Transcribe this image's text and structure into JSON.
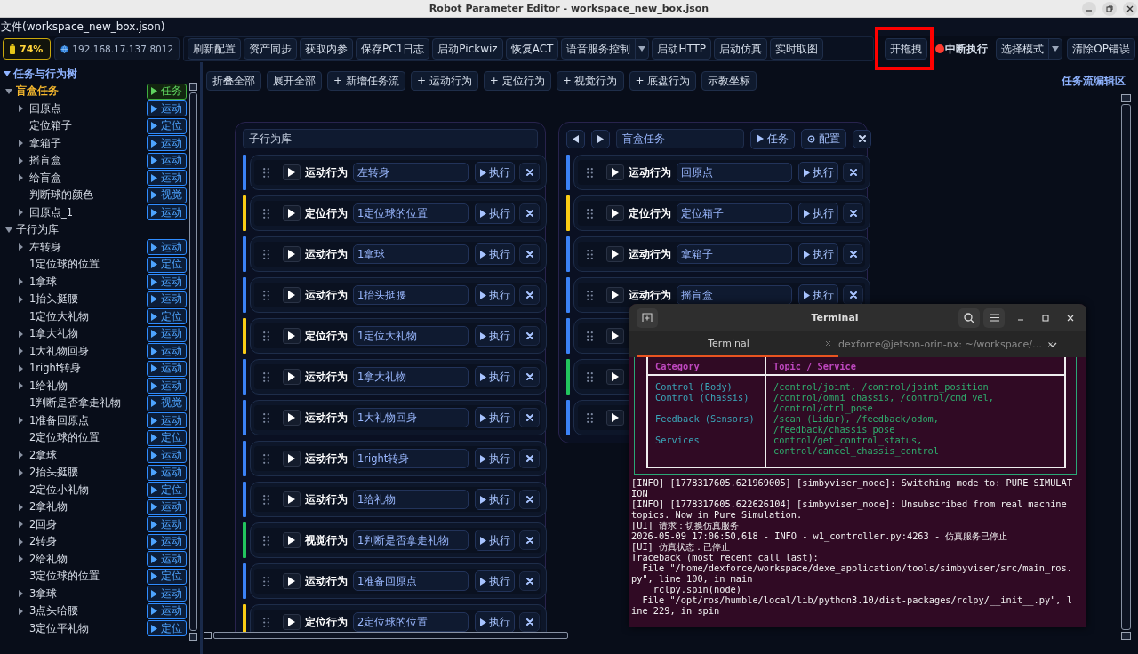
{
  "window": {
    "title": "Robot Parameter Editor - workspace_new_box.json"
  },
  "menu": {
    "file": "文件(workspace_new_box.json)"
  },
  "toolbar": {
    "battery": "74%",
    "address": "192.168.17.137:8012",
    "buttons": [
      {
        "label": "刷新配置",
        "kind": "plain"
      },
      {
        "label": "资产同步",
        "kind": "plain"
      },
      {
        "label": "获取内参",
        "kind": "plain"
      },
      {
        "label": "保存PC1日志",
        "kind": "plain"
      },
      {
        "label": "启动Pickwiz",
        "kind": "plain"
      },
      {
        "label": "恢复ACT",
        "kind": "plain"
      },
      {
        "label": "语音服务控制",
        "kind": "dropdown"
      },
      {
        "label": "启动HTTP",
        "kind": "plain"
      },
      {
        "label": "启动仿真",
        "kind": "plain"
      },
      {
        "label": "实时取图",
        "kind": "plain"
      }
    ],
    "right_buttons": [
      {
        "label": "开拖拽",
        "kind": "plain",
        "highlighted": true
      },
      {
        "label": "中断执行",
        "kind": "stop",
        "highlighted": false
      },
      {
        "label": "选择模式",
        "kind": "dropdown",
        "highlighted": false
      },
      {
        "label": "清除OP错误",
        "kind": "plain",
        "highlighted": false
      }
    ]
  },
  "tree": {
    "title": "任务与行为树",
    "expanded": true,
    "groups": [
      {
        "label": "盲盒任务",
        "kind": "task",
        "expanded": true,
        "tag": "任务",
        "children": [
          {
            "label": "回原点",
            "expandable": true,
            "tag": "运动"
          },
          {
            "label": "定位箱子",
            "expandable": false,
            "tag": "定位"
          },
          {
            "label": "拿箱子",
            "expandable": true,
            "tag": "运动"
          },
          {
            "label": "摇盲盒",
            "expandable": true,
            "tag": "运动"
          },
          {
            "label": "给盲盒",
            "expandable": true,
            "tag": "运动"
          },
          {
            "label": "判断球的颜色",
            "expandable": false,
            "tag": "视觉"
          },
          {
            "label": "回原点_1",
            "expandable": true,
            "tag": "运动"
          }
        ]
      },
      {
        "label": "子行为库",
        "kind": "library",
        "expanded": true,
        "children": [
          {
            "label": "左转身",
            "expandable": true,
            "tag": "运动"
          },
          {
            "label": "1定位球的位置",
            "expandable": false,
            "tag": "定位"
          },
          {
            "label": "1拿球",
            "expandable": true,
            "tag": "运动"
          },
          {
            "label": "1抬头挺腰",
            "expandable": true,
            "tag": "运动"
          },
          {
            "label": "1定位大礼物",
            "expandable": false,
            "tag": "定位"
          },
          {
            "label": "1拿大礼物",
            "expandable": true,
            "tag": "运动"
          },
          {
            "label": "1大礼物回身",
            "expandable": true,
            "tag": "运动"
          },
          {
            "label": "1right转身",
            "expandable": true,
            "tag": "运动"
          },
          {
            "label": "1给礼物",
            "expandable": true,
            "tag": "运动"
          },
          {
            "label": "1判断是否拿走礼物",
            "expandable": false,
            "tag": "视觉"
          },
          {
            "label": "1准备回原点",
            "expandable": true,
            "tag": "运动"
          },
          {
            "label": "2定位球的位置",
            "expandable": false,
            "tag": "定位"
          },
          {
            "label": "2拿球",
            "expandable": true,
            "tag": "运动"
          },
          {
            "label": "2抬头挺腰",
            "expandable": true,
            "tag": "运动"
          },
          {
            "label": "2定位小礼物",
            "expandable": false,
            "tag": "定位"
          },
          {
            "label": "2拿礼物",
            "expandable": true,
            "tag": "运动"
          },
          {
            "label": "2回身",
            "expandable": true,
            "tag": "运动"
          },
          {
            "label": "2转身",
            "expandable": true,
            "tag": "运动"
          },
          {
            "label": "2给礼物",
            "expandable": true,
            "tag": "运动"
          },
          {
            "label": "3定位球的位置",
            "expandable": false,
            "tag": "定位"
          },
          {
            "label": "3拿球",
            "expandable": true,
            "tag": "运动"
          },
          {
            "label": "3点头哈腰",
            "expandable": true,
            "tag": "运动"
          },
          {
            "label": "3定位平礼物",
            "expandable": false,
            "tag": "定位"
          }
        ]
      }
    ]
  },
  "editor": {
    "actions": [
      "折叠全部",
      "展开全部",
      "+ 新增任务流",
      "+ 运动行为",
      "+ 定位行为",
      "+ 视觉行为",
      "+ 底盘行为",
      "示教坐标"
    ],
    "area_label": "任务流编辑区",
    "library": {
      "title": "子行为库",
      "rows": [
        {
          "kind": "motion",
          "label": "运动行为",
          "name": "左转身",
          "run": "执行"
        },
        {
          "kind": "locate",
          "label": "定位行为",
          "name": "1定位球的位置",
          "run": "执行"
        },
        {
          "kind": "motion",
          "label": "运动行为",
          "name": "1拿球",
          "run": "执行"
        },
        {
          "kind": "motion",
          "label": "运动行为",
          "name": "1抬头挺腰",
          "run": "执行"
        },
        {
          "kind": "locate",
          "label": "定位行为",
          "name": "1定位大礼物",
          "run": "执行"
        },
        {
          "kind": "motion",
          "label": "运动行为",
          "name": "1拿大礼物",
          "run": "执行"
        },
        {
          "kind": "motion",
          "label": "运动行为",
          "name": "1大礼物回身",
          "run": "执行"
        },
        {
          "kind": "motion",
          "label": "运动行为",
          "name": "1right转身",
          "run": "执行"
        },
        {
          "kind": "motion",
          "label": "运动行为",
          "name": "1给礼物",
          "run": "执行"
        },
        {
          "kind": "vision",
          "label": "视觉行为",
          "name": "1判断是否拿走礼物",
          "run": "执行"
        },
        {
          "kind": "motion",
          "label": "运动行为",
          "name": "1准备回原点",
          "run": "执行"
        },
        {
          "kind": "locate",
          "label": "定位行为",
          "name": "2定位球的位置",
          "run": "执行"
        }
      ]
    },
    "flow": {
      "name": "盲盒任务",
      "task_button": "任务",
      "config_button": "配置",
      "rows": [
        {
          "kind": "motion",
          "label": "运动行为",
          "name": "回原点",
          "run": "执行"
        },
        {
          "kind": "locate",
          "label": "定位行为",
          "name": "定位箱子",
          "run": "执行"
        },
        {
          "kind": "motion",
          "label": "运动行为",
          "name": "拿箱子",
          "run": "执行"
        },
        {
          "kind": "motion",
          "label": "运动行为",
          "name": "摇盲盒",
          "run": "执行"
        },
        {
          "kind": "motion"
        },
        {
          "kind": "vision"
        },
        {
          "kind": "motion"
        }
      ]
    }
  },
  "terminal": {
    "title": "Terminal",
    "tabs": [
      {
        "label": "Terminal",
        "selected": true
      },
      {
        "label": "dexforce@jetson-orin-nx: ~/workspace/…",
        "selected": false
      }
    ],
    "table": {
      "columns": [
        "Category",
        "Topic / Service"
      ],
      "rows": [
        {
          "category": "Control (Body)",
          "topics": [
            "/control/joint, /control/joint_position"
          ]
        },
        {
          "category": "Control (Chassis)",
          "topics": [
            "/control/omni_chassis, /control/cmd_vel,",
            "/control/ctrl_pose"
          ]
        },
        {
          "category": "Feedback (Sensors)",
          "topics": [
            "/scan (Lidar), /feedback/odom,",
            "/feedback/chassis_pose"
          ]
        },
        {
          "category": "Services",
          "topics": [
            "control/get_control_status,",
            "control/cancel_chassis_control"
          ]
        }
      ]
    },
    "lines": [
      "[INFO] [1778317605.621969005] [simbyviser_node]: Switching mode to: PURE SIMULAT",
      "ION",
      "[INFO] [1778317605.622626104] [simbyviser_node]: Unsubscribed from real machine",
      "topics. Now in Pure Simulation.",
      "[UI] 请求：切换仿真服务",
      "2026-05-09 17:06:50,618 - INFO - w1_controller.py:4263 - 仿真服务已停止",
      "[UI] 仿真状态：已停止",
      "Traceback (most recent call last):",
      "  File \"/home/dexforce/workspace/dexe_application/tools/simbyviser/src/main_ros.",
      "py\", line 100, in main",
      "    rclpy.spin(node)",
      "  File \"/opt/ros/humble/local/lib/python3.10/dist-packages/rclpy/__init__.py\", l",
      "ine 229, in spin"
    ]
  }
}
